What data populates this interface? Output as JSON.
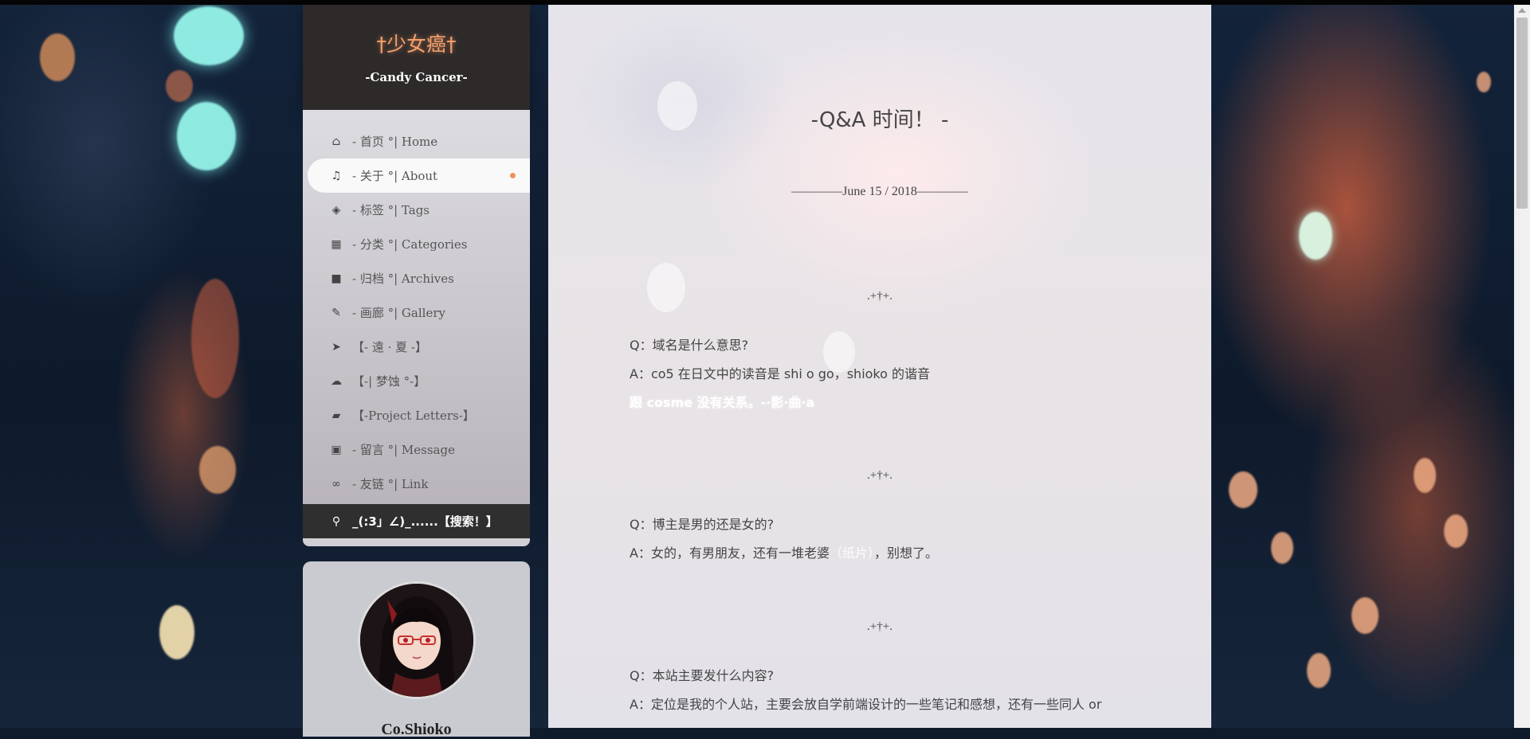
{
  "brand": {
    "title": "†少女癌†",
    "subtitle": "-Candy Cancer-"
  },
  "sidebar": {
    "items": [
      {
        "label": "- 首页 °| Home",
        "icon": "home-icon"
      },
      {
        "label": "- 关于 °| About",
        "icon": "music-icon",
        "active": true
      },
      {
        "label": "- 标签 °| Tags",
        "icon": "tags-icon"
      },
      {
        "label": "- 分类 °| Categories",
        "icon": "grid-icon"
      },
      {
        "label": "- 归档 °| Archives",
        "icon": "archive-icon"
      },
      {
        "label": "- 画廊 °| Gallery",
        "icon": "brush-icon"
      },
      {
        "label": "【- 遠 · 夏 -】",
        "icon": "paper-plane-icon"
      },
      {
        "label": "【-| 梦蚀 °-】",
        "icon": "cloud-icon"
      },
      {
        "label": "【-Project Letters-】",
        "icon": "sticky-note-icon"
      },
      {
        "label": "- 留言 °| Message",
        "icon": "image-icon"
      },
      {
        "label": "- 友链 °| Link",
        "icon": "link-icon"
      }
    ],
    "search_label": "_(:3」∠)_......【搜索！】",
    "search_icon": "search-icon"
  },
  "profile": {
    "name": "Co.Shioko"
  },
  "post": {
    "title": "-Q&A 时间！ -",
    "date": "————June 15 / 2018————",
    "divider": ".+†+.",
    "qa": [
      {
        "q": "Q：域名是什么意思?",
        "a": "A：co5 在日文中的读音是 shi o go，shioko 的谐音",
        "hidden": "跟 cosme 没有关系。-·影·曲·a"
      },
      {
        "q": "Q：博主是男的还是女的?",
        "a_before": "A：女的，有男朋友，还有一堆老婆",
        "a_hidden": "（纸片）",
        "a_after": "，别想了。"
      },
      {
        "q": "Q：本站主要发什么内容?",
        "a": "A：定位是我的个人站，主要会放自学前端设计的一些笔记和感想，还有一些同人 or"
      }
    ]
  },
  "colors": {
    "brand_bg": "#2e2a2a",
    "brand_title": "#f4a06d",
    "active_dot": "#f0935b",
    "search_bg": "#2f2f2f"
  }
}
